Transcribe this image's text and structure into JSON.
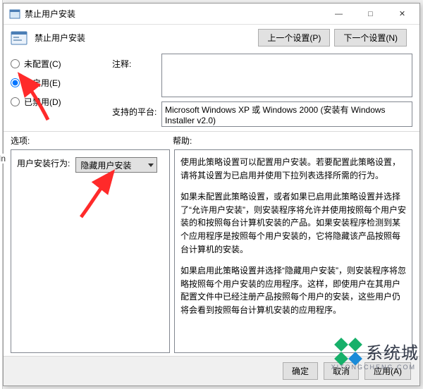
{
  "window": {
    "title": "禁止用户安装",
    "minimize": "—",
    "maximize": "□",
    "close": "✕"
  },
  "header": {
    "title": "禁止用户安装",
    "prev_btn": "上一个设置(P)",
    "next_btn": "下一个设置(N)"
  },
  "radios": {
    "not_configured": "未配置(C)",
    "enabled": "已启用(E)",
    "disabled": "已禁用(D)",
    "selected": "enabled"
  },
  "labels": {
    "comment": "注释:",
    "platform": "支持的平台:",
    "options": "选项:",
    "help": "帮助:",
    "user_install_behavior": "用户安装行为:"
  },
  "platform_text": "Microsoft Windows XP 或 Windows 2000 (安装有 Windows Installer v2.0)",
  "combo": {
    "selected": "隐藏用户安装"
  },
  "help_paragraphs": [
    "使用此策略设置可以配置用户安装。若要配置此策略设置，请将其设置为已启用并使用下拉列表选择所需的行为。",
    "如果未配置此策略设置，或者如果已启用此策略设置并选择了“允许用户安装”，则安装程序将允许并使用按照每个用户安装的和按照每台计算机安装的产品。如果安装程序检测到某个应用程序是按照每个用户安装的，它将隐藏该产品按照每台计算机的安装。",
    "如果启用此策略设置并选择“隐藏用户安装”，则安装程序将忽略按照每个用户安装的应用程序。这样，即使用户在其用户配置文件中已经注册产品按照每个用户的安装，这些用户仍将会看到按照每台计算机安装的应用程序。"
  ],
  "footer": {
    "ok": "确定",
    "cancel": "取消",
    "apply": "应用(A)"
  },
  "watermark": {
    "text": "系统城",
    "sub": "XITONGCHENG.COM"
  },
  "edge_label": "In"
}
